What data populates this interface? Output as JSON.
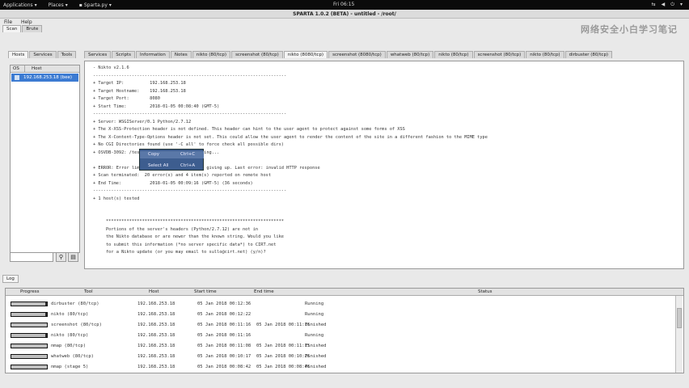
{
  "topbar": {
    "applications": "Applications",
    "places": "Places",
    "app": "Sparta.py",
    "clock": "Fri 06:15"
  },
  "window": {
    "title": "SPARTA 1.0.2 (BETA) - untitled - /root/",
    "watermark": "网络安全小白学习笔记"
  },
  "menubar": {
    "file": "File",
    "help": "Help"
  },
  "main_tabs": [
    "Scan",
    "Brute"
  ],
  "left_tabs": [
    "Hosts",
    "Services",
    "Tools"
  ],
  "host_table": {
    "col_os": "OS",
    "col_host": "Host",
    "rows": [
      {
        "host": "192.168.253.18 (bee)"
      }
    ]
  },
  "right_tabs": [
    "Services",
    "Scripts",
    "Information",
    "Notes",
    "nikto (80/tcp)",
    "screenshot (80/tcp)",
    "nikto (8080/tcp)",
    "screenshot (8080/tcp)",
    "whatweb (80/tcp)",
    "nikto (80/tcp)",
    "screenshot (80/tcp)",
    "nikto (80/tcp)",
    "dirbuster (80/tcp)"
  ],
  "output_lines": [
    "- Nikto v2.1.6",
    "---------------------------------------------------------------------------",
    "+ Target IP:          192.168.253.18",
    "+ Target Hostname:    192.168.253.18",
    "+ Target Port:        8080",
    "+ Start Time:         2018-01-05 00:08:40 (GMT-5)",
    "---------------------------------------------------------------------------",
    "+ Server: WSGIServer/0.1 Python/2.7.12",
    "+ The X-XSS-Protection header is not defined. This header can hint to the user agent to protect against some forms of XSS",
    "+ The X-Content-Type-Options header is not set. This could allow the user agent to render the content of the site in a different fashion to the MIME type",
    "+ No CGI Directories found (use '-C all' to force check all possible dirs)",
    "+ OSVDB-3092: /test: This might be interesting...",
    "",
    "+ ERROR: Error limit (20) reached for host, giving up. Last error: invalid HTTP response",
    "+ Scan terminated:  20 error(s) and 4 item(s) reported on remote host",
    "+ End Time:           2018-01-05 00:09:16 (GMT-5) (36 seconds)",
    "---------------------------------------------------------------------------",
    "+ 1 host(s) tested",
    "",
    "",
    "     *********************************************************************",
    "     Portions of the server's headers (Python/2.7.12) are not in",
    "     the Nikto database or are newer than the known string. Would you like",
    "     to submit this information (*no server specific data*) to CIRT.net",
    "     for a Nikto update (or you may email to sullo@cirt.net) (y/n)?"
  ],
  "context_menu": {
    "copy": "Copy",
    "copy_shortcut": "Ctrl+C",
    "select_all": "Select All",
    "select_all_shortcut": "Ctrl+A"
  },
  "log": {
    "tab": "Log",
    "headers": [
      "Progress",
      "Tool",
      "Host",
      "Start time",
      "End time",
      "Status"
    ],
    "rows": [
      {
        "progress": 0.95,
        "tool": "dirbuster (80/tcp)",
        "host": "192.168.253.18",
        "start": "05 Jan 2018 00:12:36",
        "end": "",
        "status": "Running"
      },
      {
        "progress": 0.95,
        "tool": "nikto (80/tcp)",
        "host": "192.168.253.18",
        "start": "05 Jan 2018 00:12:22",
        "end": "",
        "status": "Running"
      },
      {
        "progress": 1.0,
        "tool": "screenshot (80/tcp)",
        "host": "192.168.253.18",
        "start": "05 Jan 2018 00:11:16",
        "end": "05 Jan 2018 00:11:16",
        "status": "Finished"
      },
      {
        "progress": 0.95,
        "tool": "nikto (80/tcp)",
        "host": "192.168.253.18",
        "start": "05 Jan 2018 00:11:16",
        "end": "",
        "status": "Running"
      },
      {
        "progress": 1.0,
        "tool": "nmap (80/tcp)",
        "host": "192.168.253.18",
        "start": "05 Jan 2018 00:11:08",
        "end": "05 Jan 2018 00:11:15",
        "status": "Finished"
      },
      {
        "progress": 1.0,
        "tool": "whatweb (80/tcp)",
        "host": "192.168.253.18",
        "start": "05 Jan 2018 00:10:17",
        "end": "05 Jan 2018 00:10:26",
        "status": "Finished"
      },
      {
        "progress": 1.0,
        "tool": "nmap (stage 5)",
        "host": "192.168.253.18",
        "start": "05 Jan 2018 00:08:42",
        "end": "05 Jan 2018 00:08:46",
        "status": "Finished"
      }
    ]
  },
  "colors": {
    "selection": "#3c7bd2",
    "menu": "#3d5d8f"
  }
}
